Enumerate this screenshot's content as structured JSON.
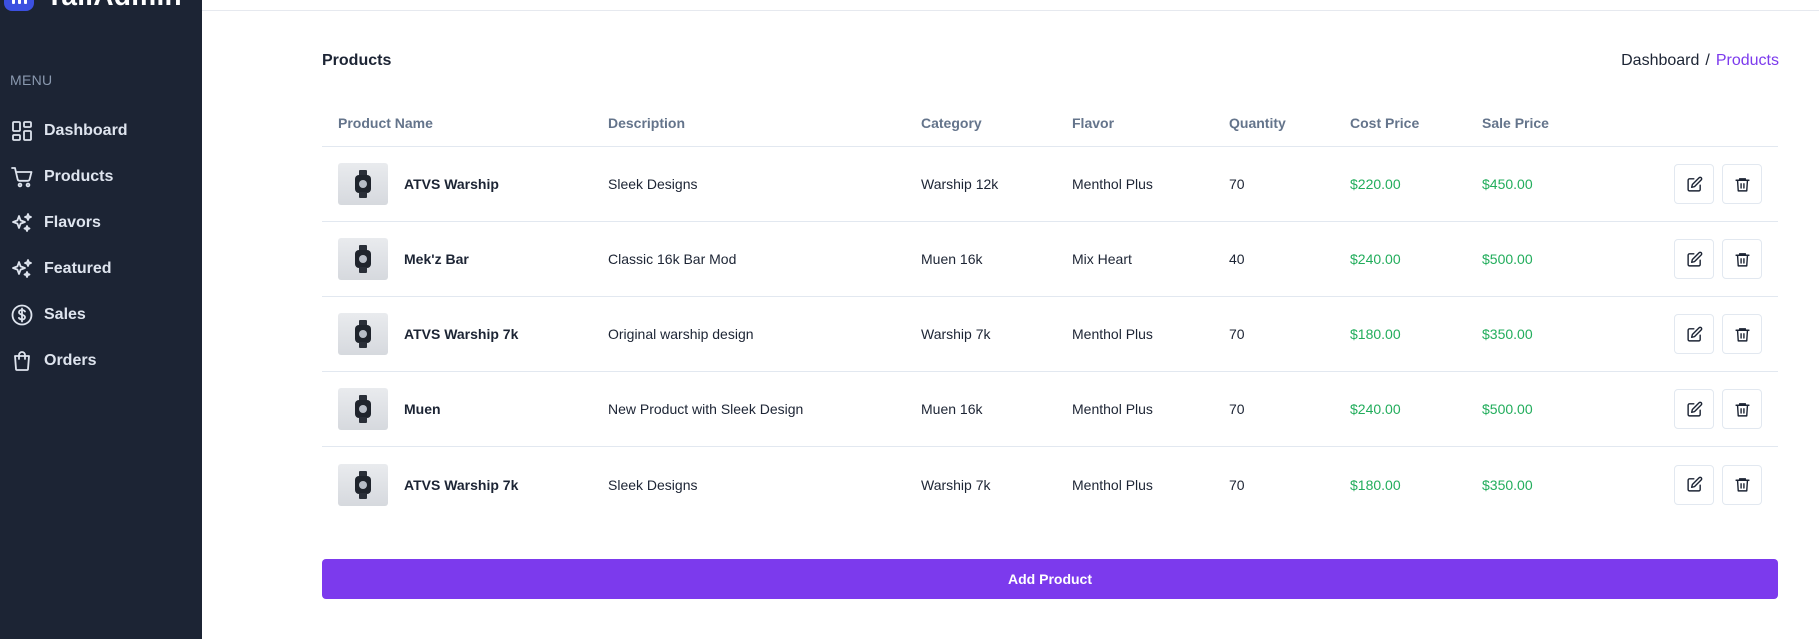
{
  "brand": {
    "name": "TailAdmin",
    "logo_icon": "bar-chart-logo"
  },
  "sidebar": {
    "heading": "MENU",
    "items": [
      {
        "key": "dashboard",
        "label": "Dashboard",
        "icon": "grid-icon"
      },
      {
        "key": "products",
        "label": "Products",
        "icon": "cart-icon"
      },
      {
        "key": "flavors",
        "label": "Flavors",
        "icon": "sparkles-icon"
      },
      {
        "key": "featured",
        "label": "Featured",
        "icon": "sparkles-icon"
      },
      {
        "key": "sales",
        "label": "Sales",
        "icon": "dollar-circle-icon"
      },
      {
        "key": "orders",
        "label": "Orders",
        "icon": "shopping-bag-icon"
      }
    ]
  },
  "page": {
    "title": "Products",
    "breadcrumb": {
      "home": "Dashboard",
      "separator": "/",
      "current": "Products"
    }
  },
  "table": {
    "headers": {
      "name": "Product Name",
      "description": "Description",
      "category": "Category",
      "flavor": "Flavor",
      "quantity": "Quantity",
      "cost_price": "Cost Price",
      "sale_price": "Sale Price"
    },
    "rows": [
      {
        "name": "ATVS Warship",
        "description": "Sleek Designs",
        "category": "Warship 12k",
        "flavor": "Menthol Plus",
        "quantity": "70",
        "cost_price": "$220.00",
        "sale_price": "$450.00"
      },
      {
        "name": "Mek'z Bar",
        "description": "Classic 16k Bar Mod",
        "category": "Muen 16k",
        "flavor": "Mix Heart",
        "quantity": "40",
        "cost_price": "$240.00",
        "sale_price": "$500.00"
      },
      {
        "name": "ATVS Warship 7k",
        "description": "Original warship design",
        "category": "Warship 7k",
        "flavor": "Menthol Plus",
        "quantity": "70",
        "cost_price": "$180.00",
        "sale_price": "$350.00"
      },
      {
        "name": "Muen",
        "description": "New Product with Sleek Design",
        "category": "Muen 16k",
        "flavor": "Menthol Plus",
        "quantity": "70",
        "cost_price": "$240.00",
        "sale_price": "$500.00"
      },
      {
        "name": "ATVS Warship 7k",
        "description": "Sleek Designs",
        "category": "Warship 7k",
        "flavor": "Menthol Plus",
        "quantity": "70",
        "cost_price": "$180.00",
        "sale_price": "$350.00"
      }
    ]
  },
  "actions": {
    "add_product": "Add Product"
  },
  "colors": {
    "sidebar_bg": "#1c2434",
    "accent": "#7c3aed",
    "price": "#22ad5c",
    "brand_blue": "#3c50e0"
  }
}
